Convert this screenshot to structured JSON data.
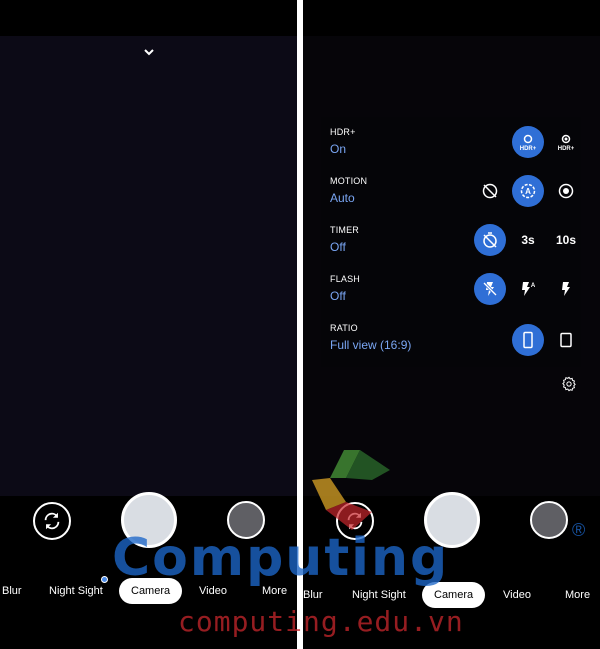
{
  "left": {
    "modes": [
      "Blur",
      "Night Sight",
      "Camera",
      "Video",
      "More"
    ],
    "active_mode": "Camera"
  },
  "right": {
    "settings": [
      {
        "label": "HDR+",
        "value": "On",
        "options": [
          "hdr-plus-on-icon",
          "hdr-plus-enhanced-icon"
        ],
        "selected": 0
      },
      {
        "label": "MOTION",
        "value": "Auto",
        "options": [
          "motion-off-icon",
          "motion-auto-icon",
          "motion-on-icon"
        ],
        "selected": 1
      },
      {
        "label": "TIMER",
        "value": "Off",
        "options": [
          "timer-off-icon",
          "3s",
          "10s"
        ],
        "selected": 0
      },
      {
        "label": "FLASH",
        "value": "Off",
        "options": [
          "flash-off-icon",
          "flash-auto-icon",
          "flash-on-icon"
        ],
        "selected": 0
      },
      {
        "label": "RATIO",
        "value": "Full view (16:9)",
        "options": [
          "ratio-full-icon",
          "ratio-4-3-icon"
        ],
        "selected": 0
      }
    ],
    "modes": [
      "Blur",
      "Night Sight",
      "Camera",
      "Video",
      "More"
    ],
    "active_mode": "Camera"
  },
  "watermark": {
    "brand": "Computing",
    "registered": "®",
    "url": "computing.edu.vn"
  },
  "colors": {
    "accent": "#2f6fd6",
    "value_text": "#7aa6f3",
    "watermark_blue": "#1d67c9",
    "watermark_red": "#c8272c"
  }
}
